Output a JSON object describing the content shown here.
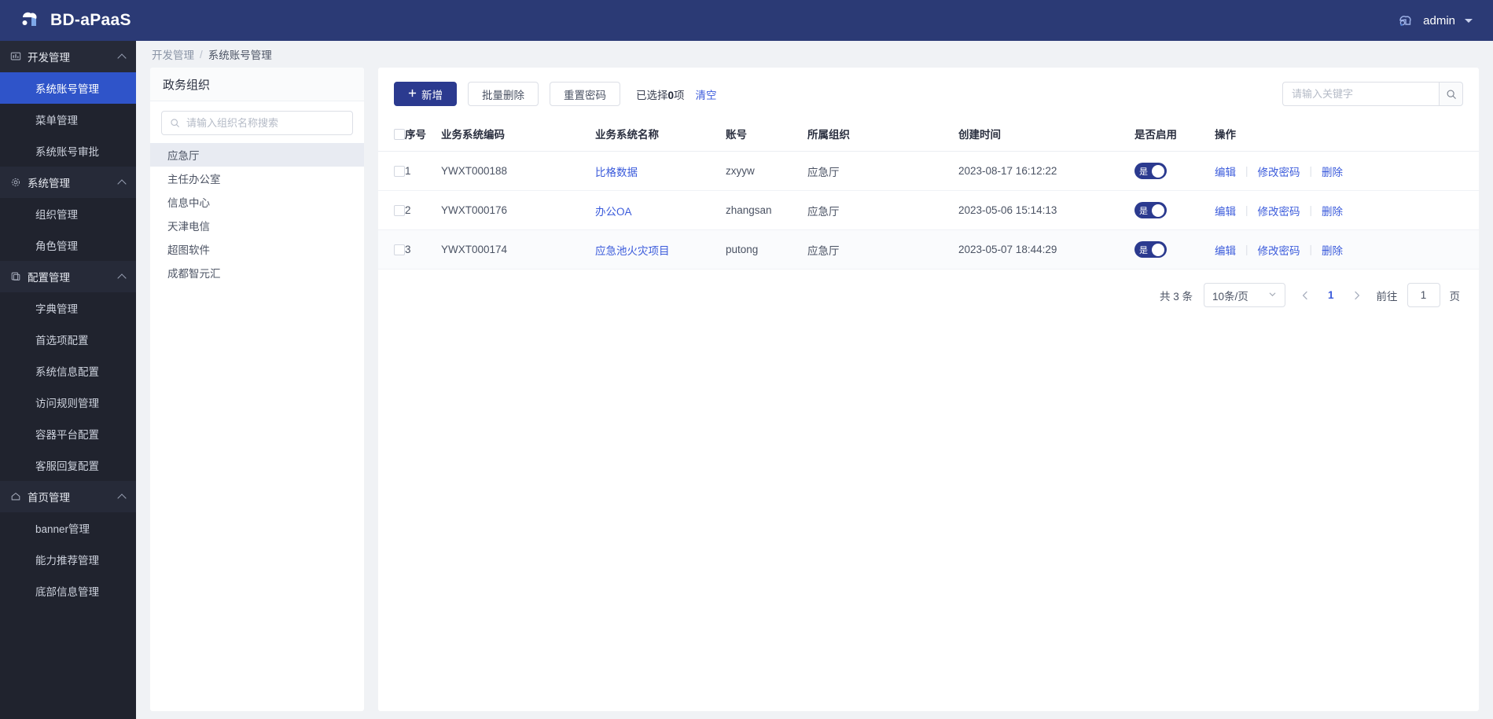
{
  "topbar": {
    "brand_title": "BD-aPaaS",
    "logo_icon": "cloud-logo-icon",
    "user_name": "admin",
    "user_avatar_icon": "user-avatar-icon",
    "caret_icon": "chevron-down-icon",
    "bg_color": "#2b3a75"
  },
  "sidebar": {
    "bg_color": "#20232e",
    "active_color": "#2f54c9",
    "groups": [
      {
        "label": "开发管理",
        "icon": "monitor-icon",
        "expanded": true,
        "items": [
          {
            "label": "系统账号管理",
            "active": true
          },
          {
            "label": "菜单管理",
            "active": false
          },
          {
            "label": "系统账号审批",
            "active": false
          }
        ]
      },
      {
        "label": "系统管理",
        "icon": "gear-icon",
        "expanded": true,
        "items": [
          {
            "label": "组织管理",
            "active": false
          },
          {
            "label": "角色管理",
            "active": false
          }
        ]
      },
      {
        "label": "配置管理",
        "icon": "copy-icon",
        "expanded": true,
        "items": [
          {
            "label": "字典管理",
            "active": false
          },
          {
            "label": "首选项配置",
            "active": false
          },
          {
            "label": "系统信息配置",
            "active": false
          },
          {
            "label": "访问规则管理",
            "active": false
          },
          {
            "label": "容器平台配置",
            "active": false
          },
          {
            "label": "客服回复配置",
            "active": false
          }
        ]
      },
      {
        "label": "首页管理",
        "icon": "home-icon",
        "expanded": true,
        "items": [
          {
            "label": "banner管理",
            "active": false
          },
          {
            "label": "能力推荐管理",
            "active": false
          },
          {
            "label": "底部信息管理",
            "active": false
          }
        ]
      }
    ]
  },
  "breadcrumb": {
    "parent": "开发管理",
    "separator": "/",
    "current": "系统账号管理"
  },
  "org_panel": {
    "title": "政务组织",
    "search_icon": "search-icon",
    "search_placeholder": "请输入组织名称搜索",
    "search_value": "",
    "items": [
      {
        "label": "应急厅",
        "selected": true
      },
      {
        "label": "主任办公室",
        "selected": false
      },
      {
        "label": "信息中心",
        "selected": false
      },
      {
        "label": "天津电信",
        "selected": false
      },
      {
        "label": "超图软件",
        "selected": false
      },
      {
        "label": "成都智元汇",
        "selected": false
      }
    ]
  },
  "toolbar": {
    "add_label": "新增",
    "add_icon": "plus-icon",
    "batch_delete_label": "批量删除",
    "reset_password_label": "重置密码",
    "selected_text_prefix": "已选择",
    "selected_count": "0",
    "selected_text_suffix": "项",
    "clear_label": "清空",
    "search_placeholder": "请输入关键字",
    "search_value": "",
    "search_icon": "search-icon",
    "primary_color": "#2b3a8f",
    "link_color": "#3b5bdb"
  },
  "table": {
    "columns": [
      {
        "key": "check",
        "label": ""
      },
      {
        "key": "index",
        "label": "序号"
      },
      {
        "key": "code",
        "label": "业务系统编码"
      },
      {
        "key": "name",
        "label": "业务系统名称"
      },
      {
        "key": "account",
        "label": "账号"
      },
      {
        "key": "org",
        "label": "所属组织"
      },
      {
        "key": "created",
        "label": "创建时间"
      },
      {
        "key": "enabled",
        "label": "是否启用"
      },
      {
        "key": "actions",
        "label": "操作"
      }
    ],
    "rows": [
      {
        "index": "1",
        "code": "YWXT000188",
        "name": "比格数据",
        "account": "zxyyw",
        "org": "应急厅",
        "created": "2023-08-17 16:12:22",
        "enabled_label": "是",
        "enabled": true
      },
      {
        "index": "2",
        "code": "YWXT000176",
        "name": "办公OA",
        "account": "zhangsan",
        "org": "应急厅",
        "created": "2023-05-06 15:14:13",
        "enabled_label": "是",
        "enabled": true
      },
      {
        "index": "3",
        "code": "YWXT000174",
        "name": "应急池火灾项目",
        "account": "putong",
        "org": "应急厅",
        "created": "2023-05-07 18:44:29",
        "enabled_label": "是",
        "enabled": true
      }
    ],
    "actions": {
      "edit_label": "编辑",
      "change_password_label": "修改密码",
      "delete_label": "删除",
      "divider": "|"
    }
  },
  "pagination": {
    "total_text": "共 3 条",
    "page_size_label": "10条/页",
    "page_size_caret_icon": "chevron-down-icon",
    "prev_icon": "chevron-left-icon",
    "next_icon": "chevron-right-icon",
    "current_page": "1",
    "jump_prefix": "前往",
    "jump_value": "1",
    "jump_suffix": "页"
  }
}
